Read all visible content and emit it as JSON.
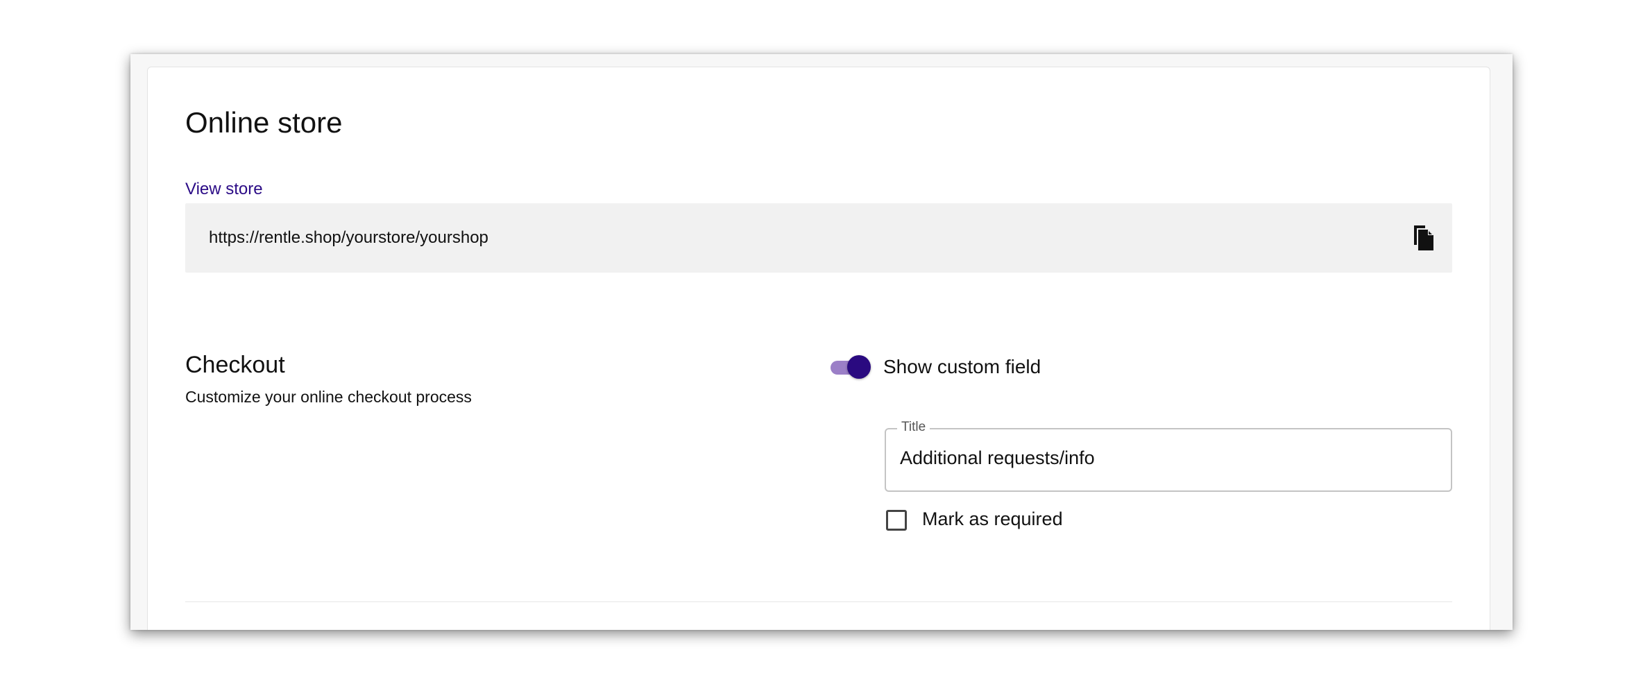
{
  "online_store": {
    "title": "Online store",
    "view_store_link": "View store",
    "store_url": "https://rentle.shop/yourstore/yourshop",
    "copy_icon": "copy-icon"
  },
  "checkout": {
    "title": "Checkout",
    "subtitle": "Customize your online checkout process",
    "custom_field_toggle": {
      "label": "Show custom field",
      "checked": true
    },
    "title_field": {
      "label": "Title",
      "value": "Additional requests/info"
    },
    "required_checkbox": {
      "label": "Mark as required",
      "checked": false
    }
  },
  "colors": {
    "accent": "#2a0a80",
    "toggle_track": "#9b7fc7",
    "link": "#2b0b86",
    "url_box_bg": "#f1f1f1"
  }
}
